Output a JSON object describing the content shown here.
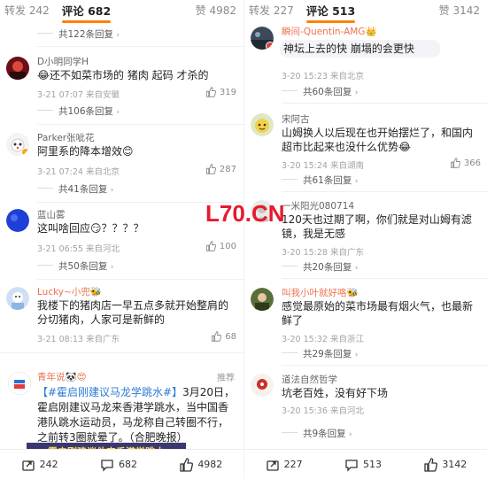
{
  "left": {
    "tabs": {
      "repost": "转发 242",
      "comments": "评论 682",
      "likes": "赞 4982"
    },
    "top_more": "共122条回复",
    "comments": [
      {
        "user": "D小明同学H",
        "text": "😂还不如菜市场的 猪肉  起码 才杀的",
        "meta": "3-21 07:07 来自安徽",
        "likes": "319",
        "more": "共106条回复"
      },
      {
        "user": "Parker张呲花",
        "text": "阿里系的降本增效😊",
        "meta": "3-21 07:24 来自北京",
        "likes": "287",
        "more": "共41条回复"
      },
      {
        "user": "蓝山雾",
        "text": "这叫啥回应😏？？？？",
        "meta": "3-21 06:55 来自河北",
        "likes": "100",
        "more": "共50条回复"
      },
      {
        "user": "Lucky~小兜🐝",
        "text": "我楼下的猪肉店一早五点多就开始整肩的分切猪肉，人家可是新鲜的",
        "meta": "3-21 08:13 来自广东",
        "likes": "68",
        "more": ""
      }
    ],
    "news": {
      "user": "青年说🐼😍",
      "recommend": "推荐",
      "hashtag": "【#霍启刚建议马龙学跳水#】",
      "text": "3月20日，霍启刚建议马龙来香港学跳水，当中国香港队跳水运动员，马龙称自己转圈不行，之前转3圈就晕了。（合肥晚报）",
      "image_caption": "霍启刚建议他来香港学跳水"
    },
    "bottom": {
      "repost": "242",
      "comments": "682",
      "likes": "4982"
    }
  },
  "right": {
    "tabs": {
      "repost": "转发 227",
      "comments": "评论 513",
      "likes": "赞 3142"
    },
    "comments": [
      {
        "user": "瞬间-Quentin-AMG👑",
        "text": "神坛上去的快  崩塌的会更快",
        "meta": "3-20 15:23 来自北京",
        "likes": "",
        "more": "共60条回复"
      },
      {
        "user": "宋阿古",
        "text": "山姆换人以后现在也开始摆烂了，和国内超市比起来也没什么优势😂",
        "meta": "3-20 15:24 来自湖南",
        "likes": "366",
        "more": "共61条回复"
      },
      {
        "user": "一米阳光080714",
        "text": "120天也过期了啊，你们就是对山姆有滤镜，我是无感",
        "meta": "3-20 15:28 来自广东",
        "likes": "",
        "more": "共20条回复"
      },
      {
        "user": "叫我小叶就好咯🐝",
        "text": "感觉最原始的菜市场最有烟火气，也最新鲜了",
        "meta": "3-20 15:32 来自浙江",
        "likes": "",
        "more": "共29条回复"
      },
      {
        "user": "道法自然哲学",
        "text": "坑老百姓，没有好下场",
        "meta": "3-20 15:36 来自河北",
        "likes": "",
        "more": "共9条回复"
      }
    ],
    "bottom": {
      "repost": "227",
      "comments": "513",
      "likes": "3142"
    }
  },
  "watermark": "L70.CN",
  "colors": {
    "accent": "#ff8200",
    "link": "#2b7bd6",
    "username_orange": "#eb7350",
    "watermark": "#e8192c"
  }
}
